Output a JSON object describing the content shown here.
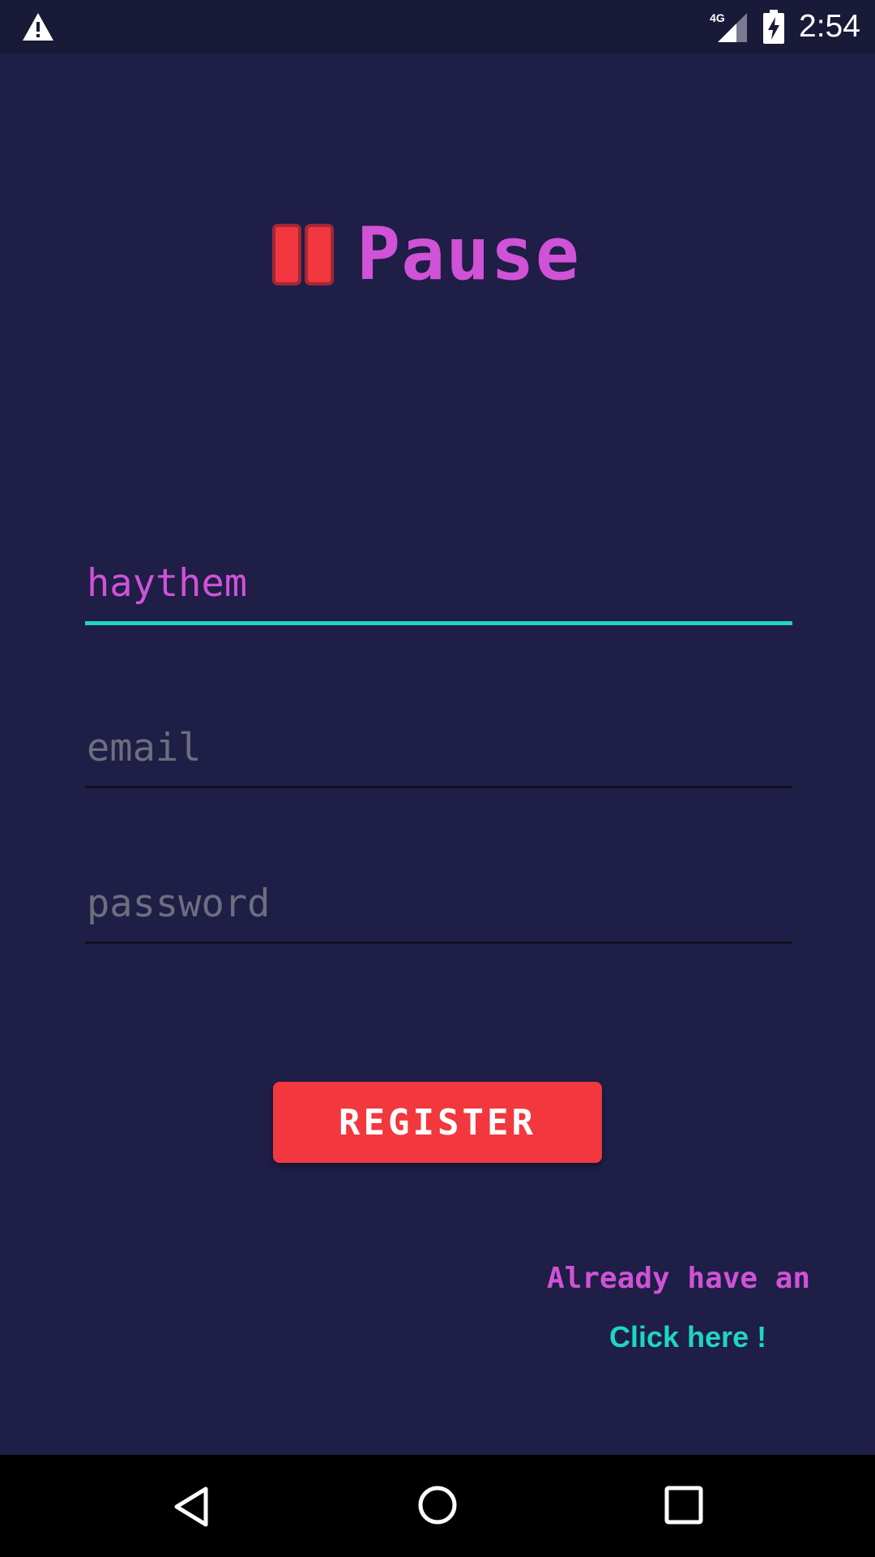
{
  "status_bar": {
    "time": "2:54",
    "network_label": "4G",
    "icons": [
      "warning-icon",
      "signal-icon",
      "battery-charging-icon"
    ]
  },
  "app": {
    "title": "Pause",
    "logo_icon": "pause-icon",
    "accent_color": "#d052d6",
    "logo_color": "#f2373e"
  },
  "form": {
    "username_value": "haythem",
    "email_placeholder": "email",
    "password_placeholder": "password",
    "register_label": "REGISTER",
    "active_underline_color": "#1fd6c0"
  },
  "footer": {
    "already_text": "Already have an",
    "click_here": "Click here !"
  },
  "nav_bar": {
    "icons": [
      "back-icon",
      "home-icon",
      "recents-icon"
    ]
  }
}
